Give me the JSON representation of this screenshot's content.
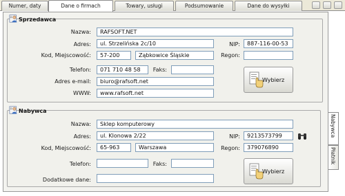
{
  "tabs": [
    {
      "label": "Numer, daty",
      "active": false
    },
    {
      "label": "Dane o firmach",
      "active": true
    },
    {
      "label": "Towary, usługi",
      "active": false
    },
    {
      "label": "Podsumowanie",
      "active": false
    },
    {
      "label": "Dane do wysyłki",
      "active": false
    }
  ],
  "side_tabs": [
    {
      "label": "Nabywca",
      "active": true
    },
    {
      "label": "Płatnik",
      "active": false
    }
  ],
  "seller": {
    "title": "Sprzedawca",
    "labels": {
      "name": "Nazwa:",
      "address": "Adres:",
      "nip": "NIP:",
      "postcode_city": "Kod, Miejscowość:",
      "regon": "Regon:",
      "phone": "Telefon:",
      "fax": "Faks:",
      "email": "Adres e-mail:",
      "www": "WWW:"
    },
    "values": {
      "name": "RAFSOFT.NET",
      "address": "ul. Strzelińska 2c/10",
      "nip": "887-116-00-53",
      "postcode": "57-200",
      "city": "Ząbkowice Śląskie",
      "regon": "",
      "phone": "071 710 48 58",
      "fax": "",
      "email": "biuro@rafsoft.net",
      "www": "www.rafsoft.net"
    },
    "select_button": "Wybierz"
  },
  "buyer": {
    "title": "Nabywca",
    "labels": {
      "name": "Nazwa:",
      "address": "Adres:",
      "nip": "NIP:",
      "postcode_city": "Kod, Miejscowość:",
      "regon": "Regon:",
      "phone": "Telefon:",
      "fax": "Faks:",
      "extra": "Dodatkowe dane:"
    },
    "values": {
      "name": "Sklep komputerowy",
      "address": "ul. Klonowa 2/22",
      "nip": "9213573799",
      "postcode": "65-963",
      "city": "Warszawa",
      "regon": "379076890",
      "phone": "",
      "fax": "",
      "extra": ""
    },
    "select_button": "Wybierz"
  },
  "icons": {
    "seller": "person-card-icon",
    "buyer": "person-card-icon",
    "nip_lookup": "binoculars-icon",
    "select": "hand-pointer-icon"
  }
}
